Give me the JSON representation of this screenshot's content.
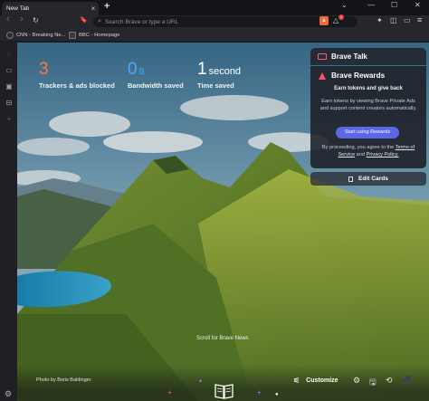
{
  "tab": {
    "title": "New Tab",
    "close_icon": "×",
    "new_tab_icon": "+"
  },
  "window_controls": {
    "dropdown": "⌄",
    "minimize": "—",
    "maximize": "☐",
    "close": "✕"
  },
  "toolbar": {
    "back_icon": "‹",
    "forward_icon": "›",
    "reload_icon": "↻",
    "bookmark_icon": "🔖",
    "url_placeholder": "Search Brave or type a URL",
    "shield_icon": "▲",
    "rewards_icon": "△",
    "rewards_badge": "1",
    "extensions_icon": "✦",
    "sidebar_icon": "◫",
    "wallet_icon": "▭",
    "menu_icon": "≡"
  },
  "bookmarks": [
    {
      "label": "CNN - Breaking Ne..."
    },
    {
      "label": "BBC - Homepage"
    }
  ],
  "sidebar": {
    "icons": [
      "◌",
      "▭",
      "▣",
      "⊟",
      "+"
    ],
    "settings_icon": "⚙"
  },
  "stats": [
    {
      "value": "3",
      "unit": "",
      "label": "Trackers & ads blocked",
      "color": "#ff7a3d"
    },
    {
      "value": "0",
      "unit": "B",
      "label": "Bandwidth saved",
      "color": "#45a8ff"
    },
    {
      "value": "1",
      "unit": "second",
      "label": "Time saved",
      "color": "#ffffff"
    }
  ],
  "brave_talk": {
    "title": "Brave Talk"
  },
  "brave_rewards": {
    "title": "Brave Rewards",
    "subtitle": "Earn tokens and give back",
    "description": "Earn tokens by viewing Brave Private Ads and support content creators automatically.",
    "button_label": "Start using Rewards",
    "terms_prefix": "By proceeding, you agree to the",
    "terms_link": "Terms of Service",
    "terms_and": "and",
    "privacy_link": "Privacy Policy."
  },
  "edit_cards": {
    "label": "Edit Cards"
  },
  "scroll_hint": "Scroll for Brave News",
  "photo_credit": "Photo by Boris Baldinger",
  "customize": {
    "label": "Customize",
    "icon": "⚟"
  },
  "bottom_icons": [
    "⚙",
    "🖫",
    "⟲",
    "⬛"
  ],
  "accent_colors": {
    "rewards": "#5b67e6",
    "brave_orange": "#ef6a3b"
  }
}
